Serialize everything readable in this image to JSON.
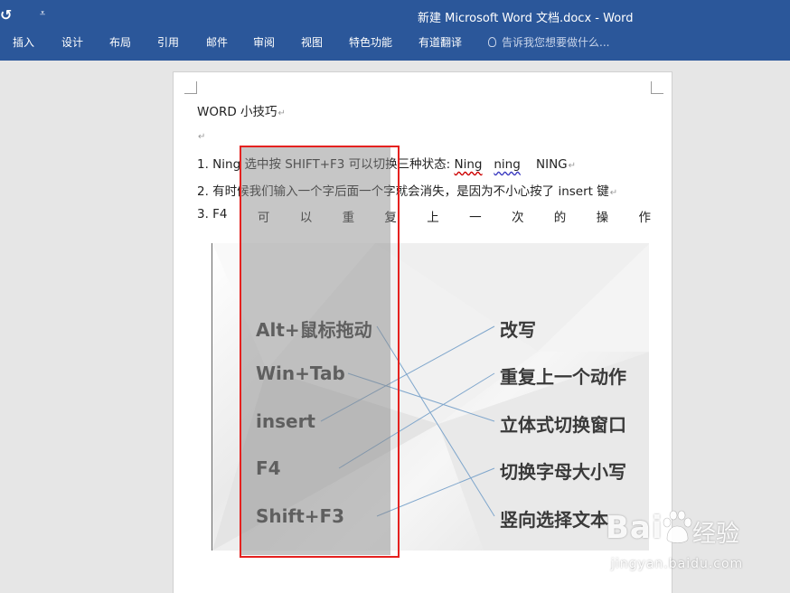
{
  "titlebar": {
    "undo_glyph": "↺",
    "qat_more_glyph": "⩡",
    "window_title": "新建 Microsoft Word 文档.docx - Word",
    "tabs": [
      "插入",
      "设计",
      "布局",
      "引用",
      "邮件",
      "审阅",
      "视图",
      "特色功能",
      "有道翻译"
    ],
    "tell_me_placeholder": "告诉我您想要做什么..."
  },
  "document": {
    "title": "WORD  小技巧",
    "pilcrow": "↵",
    "line1": {
      "prefix": "1. Ning 选中按 SHIFT+F3 可以切换三种状态:  ",
      "w1": "Ning",
      "w2": "ning",
      "w3": "NING"
    },
    "line2": "2. 有时候我们输入一个字后面一个字就会消失，是因为不小心按了 insert 键",
    "line3": [
      "3. F4",
      "可",
      "以",
      "重",
      "复",
      "上",
      "一",
      "次",
      "的",
      "操",
      "作"
    ]
  },
  "picture": {
    "left_items": [
      "Alt+鼠标拖动",
      "Win+Tab",
      "insert",
      "F4",
      "Shift+F3"
    ],
    "right_items": [
      "改写",
      "重复上一个动作",
      "立体式切换窗口",
      "切换字母大小写",
      "竖向选择文本"
    ],
    "matches": [
      [
        0,
        4
      ],
      [
        1,
        2
      ],
      [
        2,
        0
      ],
      [
        3,
        1
      ],
      [
        4,
        3
      ]
    ],
    "line_color": "#7fa6cc"
  },
  "watermark": {
    "brand": "Bai",
    "brand_suffix": "经验",
    "url": "jingyan.baidu.com"
  },
  "colors": {
    "ribbon": "#2b579a",
    "highlight_border": "#e5211f"
  }
}
